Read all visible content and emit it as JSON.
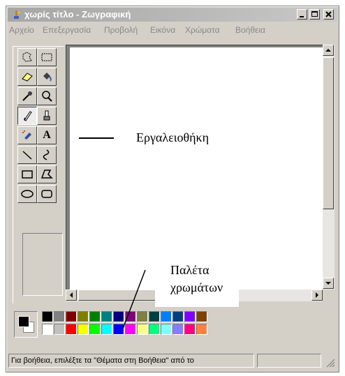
{
  "window": {
    "title": "χωρίς τίτλο - Ζωγραφική",
    "menus": [
      "Αρχείο",
      "Επεξεργασία",
      "Προβολή",
      "Εικόνα",
      "Χρώματα",
      "Βοήθεια"
    ]
  },
  "tools": [
    {
      "name": "free-form-select",
      "glyph": ""
    },
    {
      "name": "rect-select",
      "glyph": ""
    },
    {
      "name": "eraser",
      "glyph": ""
    },
    {
      "name": "fill",
      "glyph": ""
    },
    {
      "name": "pick-color",
      "glyph": ""
    },
    {
      "name": "magnifier",
      "glyph": ""
    },
    {
      "name": "pencil",
      "glyph": ""
    },
    {
      "name": "brush",
      "glyph": ""
    },
    {
      "name": "airbrush",
      "glyph": ""
    },
    {
      "name": "text",
      "glyph": "A"
    },
    {
      "name": "line",
      "glyph": ""
    },
    {
      "name": "curve",
      "glyph": ""
    },
    {
      "name": "rectangle",
      "glyph": ""
    },
    {
      "name": "polygon",
      "glyph": ""
    },
    {
      "name": "ellipse",
      "glyph": ""
    },
    {
      "name": "rounded-rectangle",
      "glyph": ""
    }
  ],
  "palette": {
    "foreground": "#000000",
    "background": "#ffffff",
    "top_row": [
      "#000000",
      "#808080",
      "#800000",
      "#808000",
      "#008000",
      "#008080",
      "#000080",
      "#800080",
      "#808040",
      "#004040",
      "#0080ff",
      "#004080",
      "#8000ff",
      "#804000"
    ],
    "bottom_row": [
      "#ffffff",
      "#c0c0c0",
      "#ff0000",
      "#ffff00",
      "#00ff00",
      "#00ffff",
      "#0000ff",
      "#ff00ff",
      "#ffff80",
      "#00ff80",
      "#80ffff",
      "#8080ff",
      "#ff0080",
      "#ff8040"
    ]
  },
  "status": {
    "help_text": "Για βοήθεια, επιλέξτε τα \"Θέματα στη Βοήθεια\" από το"
  },
  "annotations": {
    "toolbox_label": "Εργαλειοθήκη",
    "palette_label_line1": "Παλέτα",
    "palette_label_line2": "χρωμάτων"
  }
}
